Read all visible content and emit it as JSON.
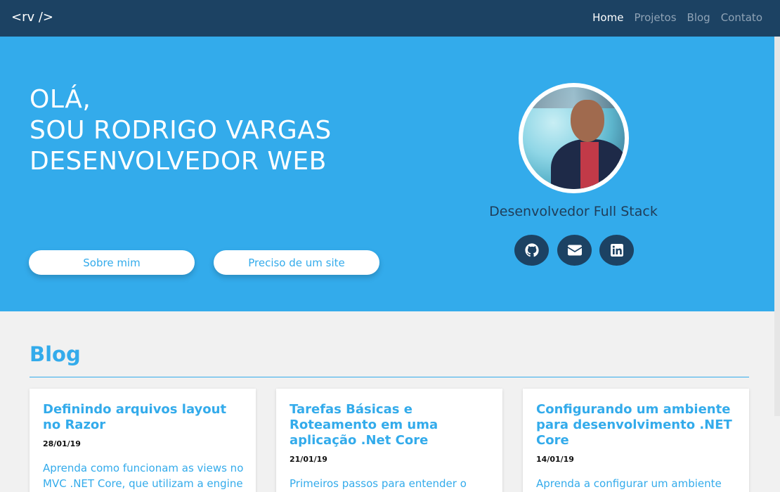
{
  "navbar": {
    "brand": "<rv />",
    "links": [
      {
        "label": "Home",
        "active": true
      },
      {
        "label": "Projetos",
        "active": false
      },
      {
        "label": "Blog",
        "active": false
      },
      {
        "label": "Contato",
        "active": false
      }
    ]
  },
  "hero": {
    "line1": "OLÁ,",
    "line2": "SOU RODRIGO VARGAS",
    "line3": "DESENVOLVEDOR WEB",
    "buttons": {
      "about": "Sobre mim",
      "site": "Preciso de um site"
    },
    "role": "Desenvolvedor Full Stack",
    "social": [
      {
        "icon": "github-icon"
      },
      {
        "icon": "mail-icon"
      },
      {
        "icon": "linkedin-icon"
      }
    ]
  },
  "blog": {
    "title": "Blog",
    "cards": [
      {
        "title": "Definindo arquivos layout no Razor",
        "date": "28/01/19",
        "excerpt": "Aprenda como funcionam as views no MVC .NET Core, que utilizam a engine"
      },
      {
        "title": "Tarefas Básicas e Roteamento em uma aplicação .Net Core",
        "date": "21/01/19",
        "excerpt": "Primeiros passos para entender o"
      },
      {
        "title": "Configurando um ambiente para desenvolvimento .NET Core",
        "date": "14/01/19",
        "excerpt": "Aprenda a configurar um ambiente"
      }
    ]
  },
  "colors": {
    "navbar": "#1c4263",
    "hero": "#33abeb",
    "accent": "#33abeb",
    "background": "#f1f1f1"
  }
}
